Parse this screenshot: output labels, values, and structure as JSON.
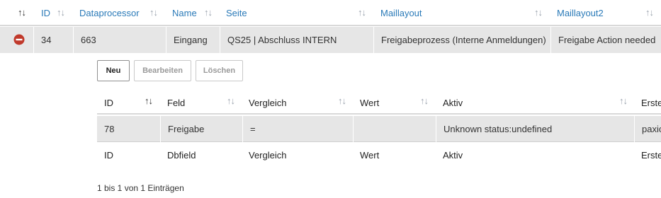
{
  "main_table": {
    "headers": {
      "id": "ID",
      "dataprocessor": "Dataprocessor",
      "name": "Name",
      "seite": "Seite",
      "maillayout": "Maillayout",
      "maillayout2": "Maillayout2"
    },
    "sort_icon": "↑↓",
    "row": {
      "id": "34",
      "dataprocessor": "663",
      "name": "Eingang",
      "seite": "QS25 | Abschluss INTERN",
      "maillayout": "Freigabeprozess (Interne Anmeldungen)",
      "maillayout2": "Freigabe Action needed"
    },
    "row_icon": "remove-circle-icon"
  },
  "toolbar": {
    "new_label": "Neu",
    "edit_label": "Bearbeiten",
    "delete_label": "Löschen"
  },
  "sub_table": {
    "headers": {
      "id": "ID",
      "feld": "Feld",
      "vergleich": "Vergleich",
      "wert": "Wert",
      "aktiv": "Aktiv",
      "erste": "Erste"
    },
    "row": {
      "id": "78",
      "feld": "Freigabe",
      "vergleich": "=",
      "wert": "",
      "aktiv": "Unknown status:undefined",
      "erste": "paxio"
    },
    "footer": {
      "id": "ID",
      "feld": "Dbfield",
      "vergleich": "Vergleich",
      "wert": "Wert",
      "aktiv": "Aktiv",
      "erste": "Erste"
    },
    "info": "1 bis 1 von 1 Einträgen"
  },
  "colors": {
    "link_header": "#2a7ab8",
    "row_bg": "#e6e6e6",
    "remove_icon": "#c0392b"
  }
}
